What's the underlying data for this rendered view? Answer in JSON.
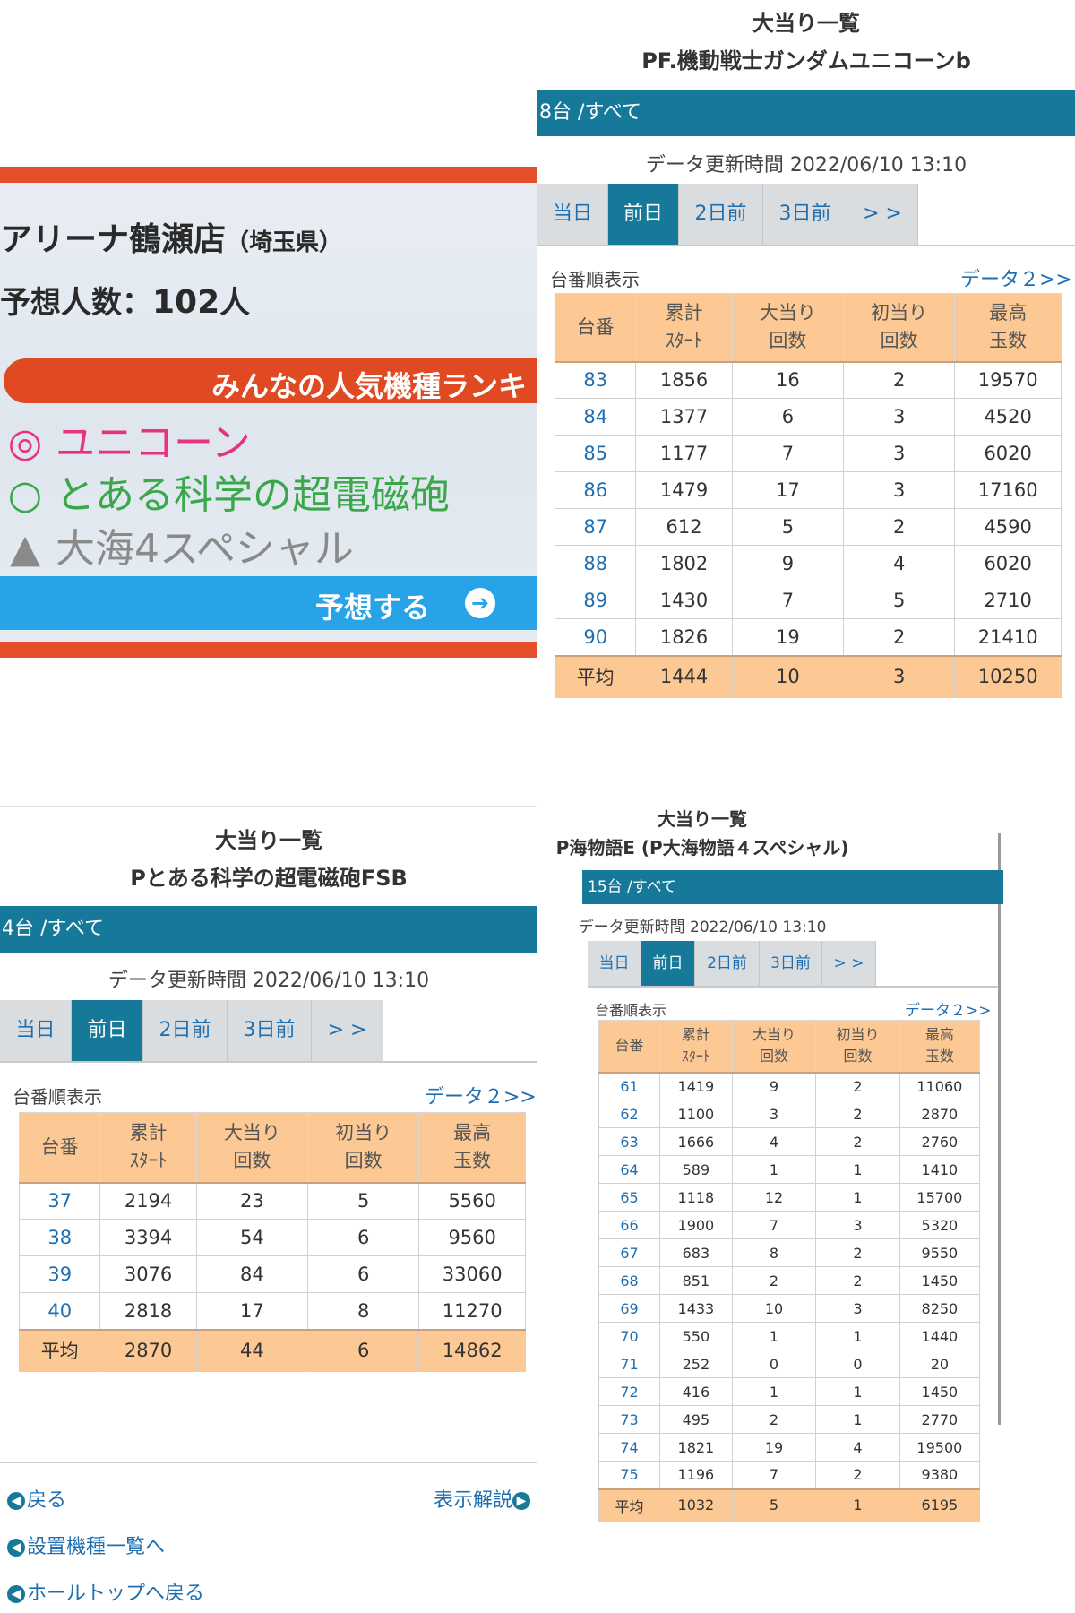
{
  "banner": {
    "store_name": "アリーナ鶴瀬店",
    "store_pref": "（埼玉県）",
    "forecast_label": "予想人数：",
    "forecast_value": "102",
    "forecast_unit": "人",
    "ranking_title": "みんなの人気機種ランキ",
    "ranking": [
      {
        "mark": "◎",
        "name": "ユニコーン",
        "color": "#e8317f"
      },
      {
        "mark": "○",
        "name": "とある科学の超電磁砲",
        "color": "#3aa84a"
      },
      {
        "mark": "▲",
        "name": "大海4スペシャル",
        "color": "#8a8a8a"
      }
    ],
    "predict_button": "予想する",
    "accent_color": "#e5502a",
    "button_color": "#29a3e8"
  },
  "gundam": {
    "title": "大当り一覧",
    "machine": "PF.機動戦士ガンダムユニコーンb",
    "count": "8台 /すべて",
    "updated": "データ更新時間 2022/06/10 13:10",
    "tabs": [
      "当日",
      "前日",
      "2日前",
      "3日前",
      "> >"
    ],
    "active_tab": "前日",
    "sort_label": "台番順表示",
    "data2": "データ２>>",
    "headers": [
      [
        "台番"
      ],
      [
        "累計",
        "ｽﾀｰﾄ"
      ],
      [
        "大当り",
        "回数"
      ],
      [
        "初当り",
        "回数"
      ],
      [
        "最高",
        "玉数"
      ]
    ],
    "rows": [
      [
        "83",
        "1856",
        "16",
        "2",
        "19570"
      ],
      [
        "84",
        "1377",
        "6",
        "3",
        "4520"
      ],
      [
        "85",
        "1177",
        "7",
        "3",
        "6020"
      ],
      [
        "86",
        "1479",
        "17",
        "3",
        "17160"
      ],
      [
        "87",
        "612",
        "5",
        "2",
        "4590"
      ],
      [
        "88",
        "1802",
        "9",
        "4",
        "6020"
      ],
      [
        "89",
        "1430",
        "7",
        "5",
        "2710"
      ],
      [
        "90",
        "1826",
        "19",
        "2",
        "21410"
      ]
    ],
    "average": [
      "平均",
      "1444",
      "10",
      "3",
      "10250"
    ]
  },
  "railgun": {
    "title": "大当り一覧",
    "machine": "Pとある科学の超電磁砲FSB",
    "count": "4台 /すべて",
    "updated": "データ更新時間 2022/06/10 13:10",
    "tabs": [
      "当日",
      "前日",
      "2日前",
      "3日前",
      "> >"
    ],
    "active_tab": "前日",
    "sort_label": "台番順表示",
    "data2": "データ２>>",
    "headers": [
      [
        "台番"
      ],
      [
        "累計",
        "ｽﾀｰﾄ"
      ],
      [
        "大当り",
        "回数"
      ],
      [
        "初当り",
        "回数"
      ],
      [
        "最高",
        "玉数"
      ]
    ],
    "rows": [
      [
        "37",
        "2194",
        "23",
        "5",
        "5560"
      ],
      [
        "38",
        "3394",
        "54",
        "6",
        "9560"
      ],
      [
        "39",
        "3076",
        "84",
        "6",
        "33060"
      ],
      [
        "40",
        "2818",
        "17",
        "8",
        "11270"
      ]
    ],
    "average": [
      "平均",
      "2870",
      "44",
      "6",
      "14862"
    ],
    "footer": {
      "back": "戻る",
      "explain": "表示解説",
      "machine_list": "設置機種一覧へ",
      "hall_top": "ホールトップへ戻る"
    }
  },
  "umi": {
    "title": "大当り一覧",
    "machine": "P海物語E (P大海物語４スペシャル)",
    "count": "15台 /すべて",
    "updated": "データ更新時間 2022/06/10 13:10",
    "tabs": [
      "当日",
      "前日",
      "2日前",
      "3日前",
      "> >"
    ],
    "active_tab": "前日",
    "sort_label": "台番順表示",
    "data2": "データ２>>",
    "headers": [
      [
        "台番"
      ],
      [
        "累計",
        "ｽﾀｰﾄ"
      ],
      [
        "大当り",
        "回数"
      ],
      [
        "初当り",
        "回数"
      ],
      [
        "最高",
        "玉数"
      ]
    ],
    "rows": [
      [
        "61",
        "1419",
        "9",
        "2",
        "11060"
      ],
      [
        "62",
        "1100",
        "3",
        "2",
        "2870"
      ],
      [
        "63",
        "1666",
        "4",
        "2",
        "2760"
      ],
      [
        "64",
        "589",
        "1",
        "1",
        "1410"
      ],
      [
        "65",
        "1118",
        "12",
        "1",
        "15700"
      ],
      [
        "66",
        "1900",
        "7",
        "3",
        "5320"
      ],
      [
        "67",
        "683",
        "8",
        "2",
        "9550"
      ],
      [
        "68",
        "851",
        "2",
        "2",
        "1450"
      ],
      [
        "69",
        "1433",
        "10",
        "3",
        "8250"
      ],
      [
        "70",
        "550",
        "1",
        "1",
        "1440"
      ],
      [
        "71",
        "252",
        "0",
        "0",
        "20"
      ],
      [
        "72",
        "416",
        "1",
        "1",
        "1450"
      ],
      [
        "73",
        "495",
        "2",
        "1",
        "2770"
      ],
      [
        "74",
        "1821",
        "19",
        "4",
        "19500"
      ],
      [
        "75",
        "1196",
        "7",
        "2",
        "9380"
      ]
    ],
    "average": [
      "平均",
      "1032",
      "5",
      "1",
      "6195"
    ]
  }
}
